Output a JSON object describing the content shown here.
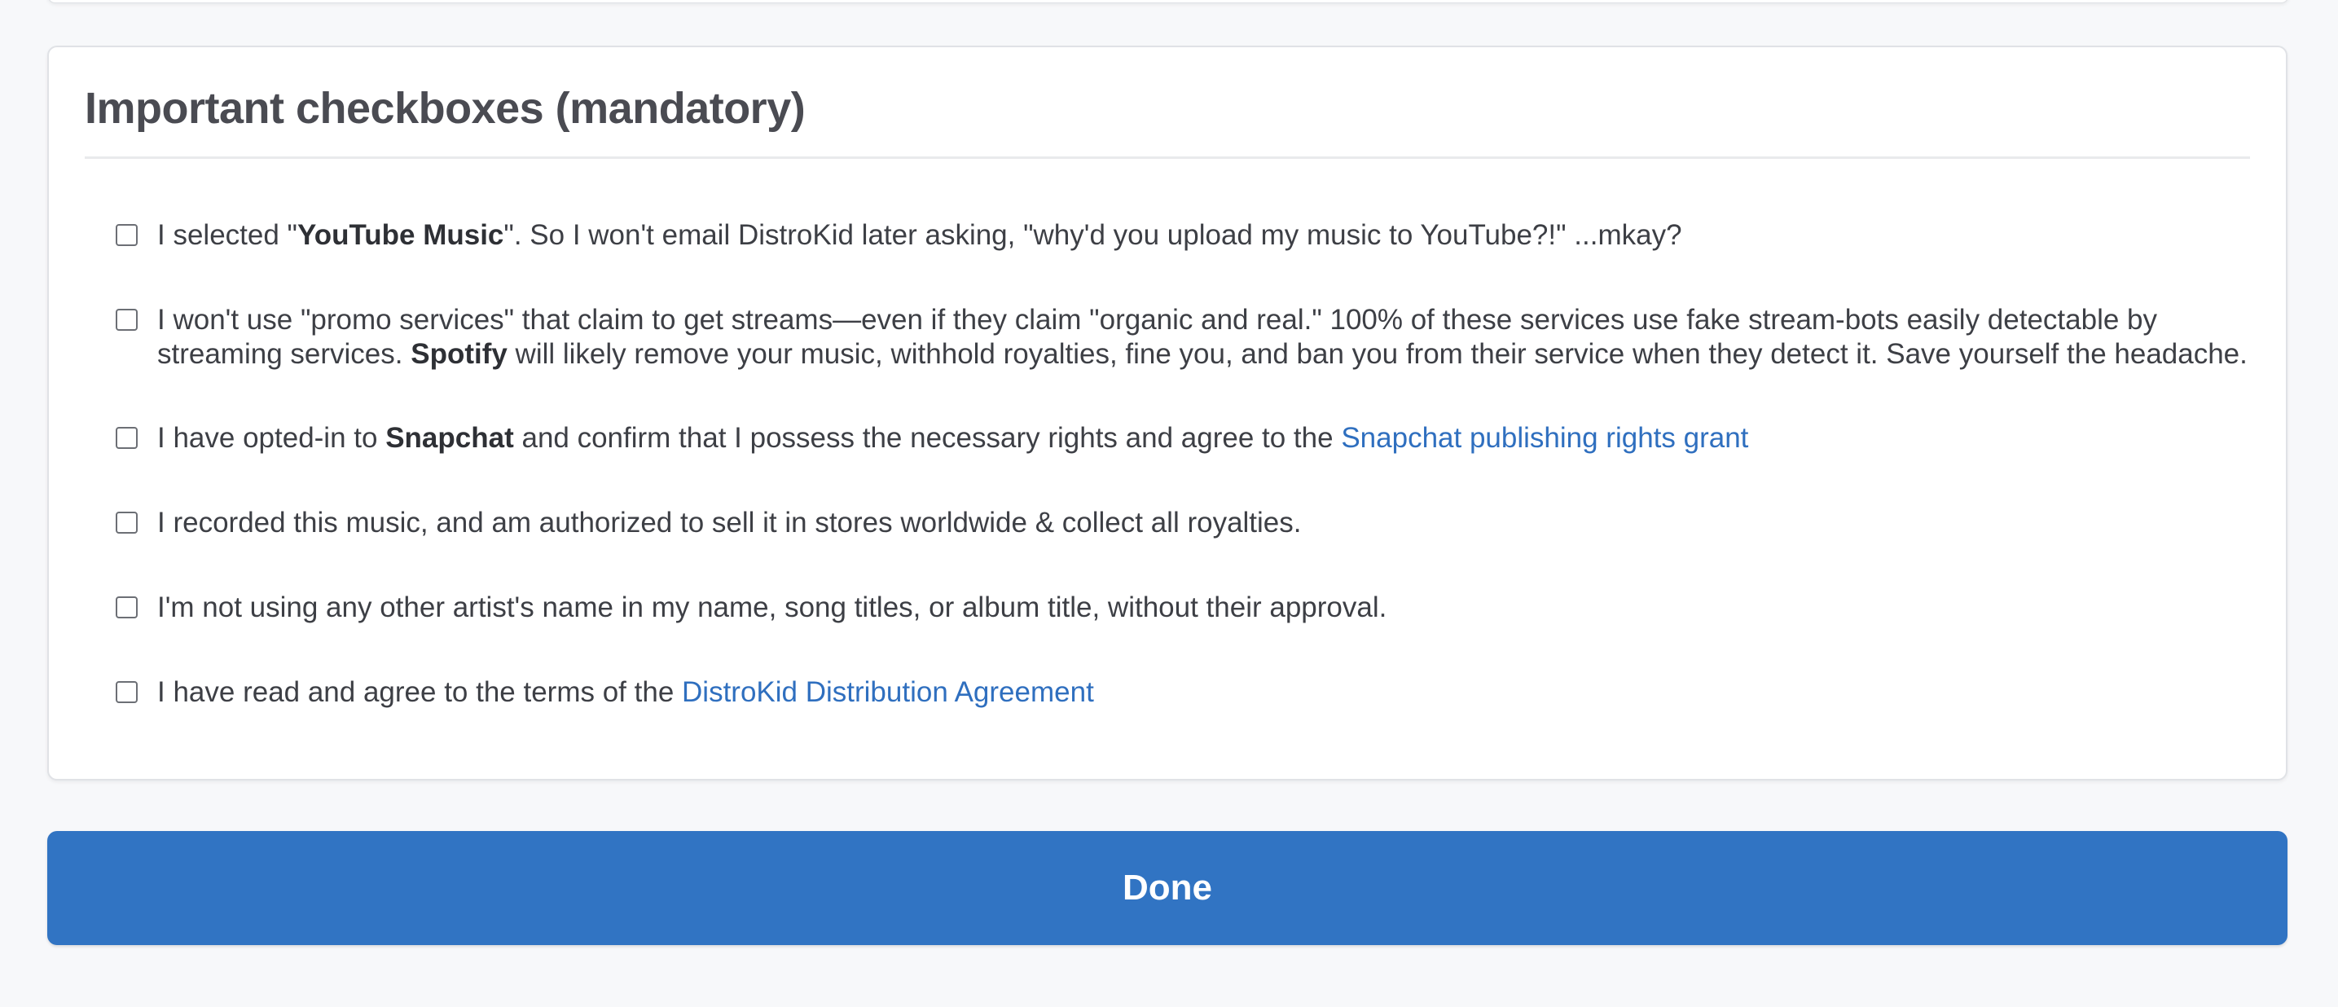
{
  "section": {
    "title": "Important checkboxes (mandatory)"
  },
  "checkboxes": [
    {
      "checked": false,
      "parts": [
        {
          "text": "I selected \""
        },
        {
          "text": "YouTube Music",
          "bold": true
        },
        {
          "text": "\". So I won't email DistroKid later asking, \"why'd you upload my music to YouTube?!\" ...mkay?"
        }
      ]
    },
    {
      "checked": false,
      "parts": [
        {
          "text": "I won't use \"promo services\" that claim to get streams—even if they claim \"organic and real.\" 100% of these services use fake stream-bots easily detectable by streaming services. "
        },
        {
          "text": "Spotify",
          "bold": true
        },
        {
          "text": " will likely remove your music, withhold royalties, fine you, and ban you from their service when they detect it. Save yourself the headache."
        }
      ]
    },
    {
      "checked": false,
      "parts": [
        {
          "text": "I have opted-in to "
        },
        {
          "text": "Snapchat",
          "bold": true
        },
        {
          "text": " and confirm that I possess the necessary rights and agree to the "
        },
        {
          "text": "Snapchat publishing rights grant",
          "link": true
        }
      ]
    },
    {
      "checked": false,
      "parts": [
        {
          "text": "I recorded this music, and am authorized to sell it in stores worldwide & collect all royalties."
        }
      ]
    },
    {
      "checked": false,
      "parts": [
        {
          "text": "I'm not using any other artist's name in my name, song titles, or album title, without their approval."
        }
      ]
    },
    {
      "checked": false,
      "parts": [
        {
          "text": "I have read and agree to the terms of the "
        },
        {
          "text": "DistroKid Distribution Agreement",
          "link": true
        }
      ]
    }
  ],
  "done_button": {
    "label": "Done"
  },
  "colors": {
    "page_background": "#f7f8fa",
    "card_background": "#ffffff",
    "link": "#2f6fbf",
    "button": "#3174c3",
    "button_text": "#ffffff"
  }
}
